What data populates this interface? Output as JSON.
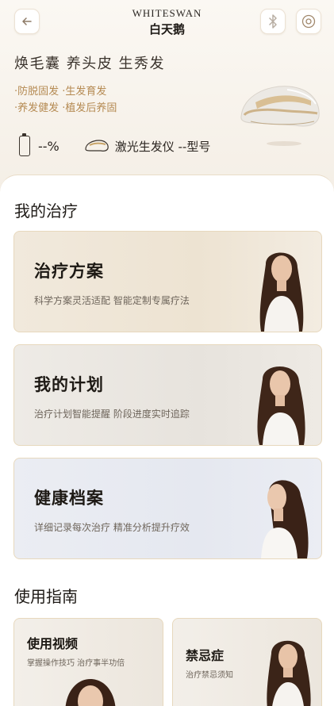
{
  "header": {
    "brand_en": "WHITESWAN",
    "brand_cn": "白天鹅",
    "back_icon": "back-arrow-icon",
    "bluetooth_icon": "bluetooth-icon",
    "settings_icon": "settings-icon"
  },
  "hero": {
    "slogan": "焕毛囊 养头皮 生秀发",
    "features": [
      "·防脱固发 ·生发育发",
      "·养发健发 ·植发后养固"
    ],
    "battery_text": "--%",
    "device_text": "激光生发仪 --型号"
  },
  "treatment": {
    "section_title": "我的治疗",
    "cards": [
      {
        "title": "治疗方案",
        "subtitle": "科学方案灵活适配 智能定制专属疗法"
      },
      {
        "title": "我的计划",
        "subtitle": "治疗计划智能提醒 阶段进度实时追踪"
      },
      {
        "title": "健康档案",
        "subtitle": "详细记录每次治疗 精准分析提升疗效"
      }
    ]
  },
  "guide": {
    "section_title": "使用指南",
    "cards": [
      {
        "title": "使用视频",
        "subtitle": "掌握操作技巧 治疗事半功倍"
      },
      {
        "title": "禁忌症",
        "subtitle": "治疗禁忌须知"
      }
    ]
  },
  "colors": {
    "accent_gold": "#b58a52",
    "card_border": "#e7d8bd"
  }
}
